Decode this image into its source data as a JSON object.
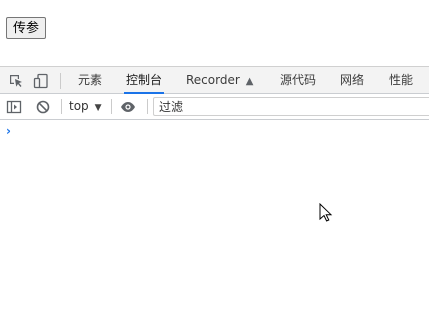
{
  "page": {
    "button_label": "传参"
  },
  "devtools": {
    "tabs": [
      {
        "label": "元素",
        "active": false
      },
      {
        "label": "控制台",
        "active": true
      },
      {
        "label": "Recorder",
        "active": false
      },
      {
        "label": "源代码",
        "active": false
      },
      {
        "label": "网络",
        "active": false
      },
      {
        "label": "性能",
        "active": false
      }
    ],
    "toolbar": {
      "context": "top",
      "filter_placeholder": "过滤"
    },
    "console": {
      "prompt": "›"
    },
    "accent_color": "#1a73e8"
  }
}
